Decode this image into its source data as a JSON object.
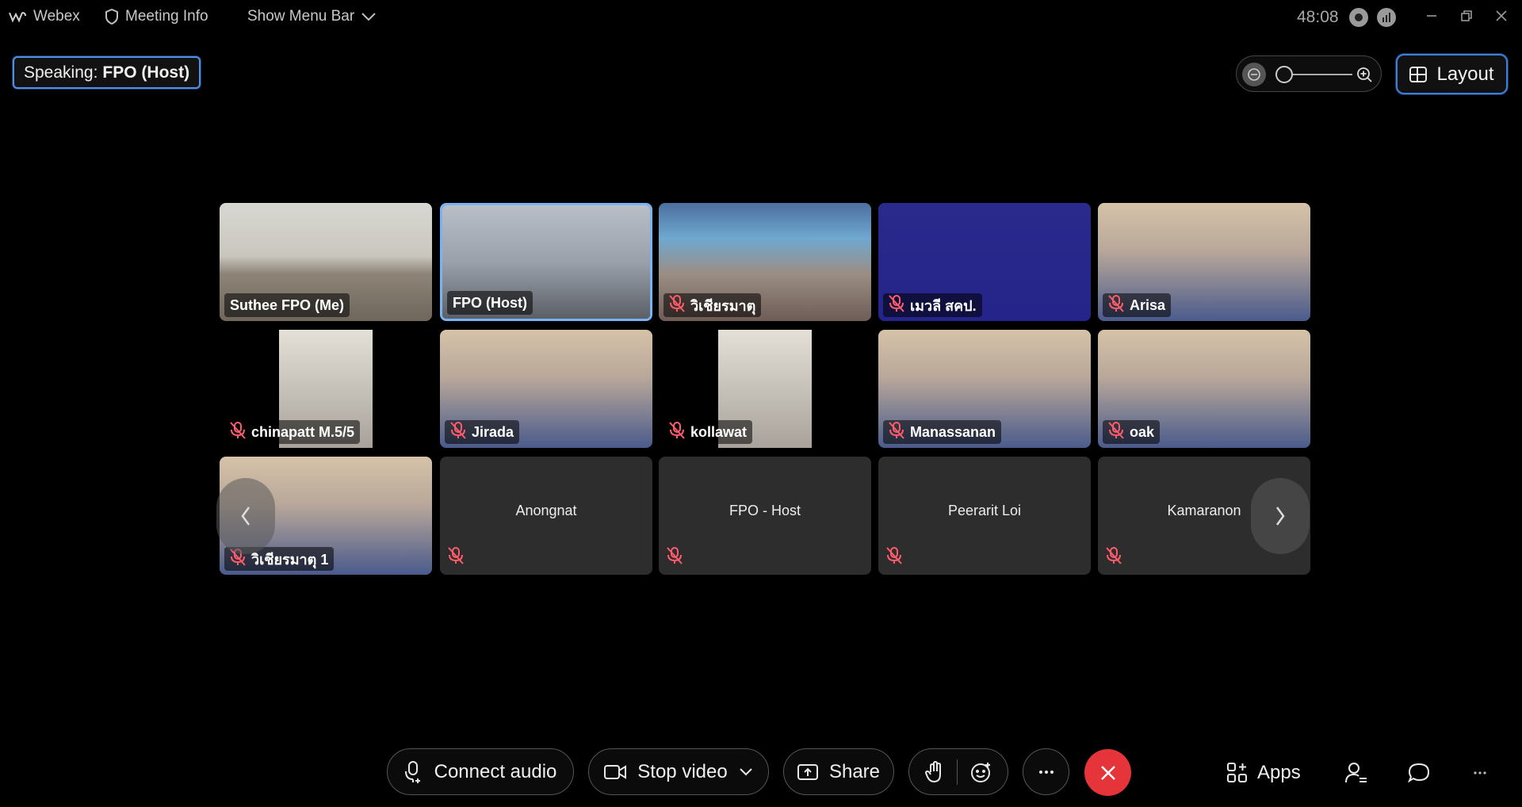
{
  "titlebar": {
    "app_name": "Webex",
    "meeting_info": "Meeting Info",
    "show_menu_bar": "Show Menu Bar",
    "timer": "48:08"
  },
  "speaking": {
    "label": "Speaking:",
    "name": "FPO (Host)"
  },
  "layout_label": "Layout",
  "participants": [
    {
      "name": "Suthee FPO (Me)",
      "muted": false,
      "video": true
    },
    {
      "name": "FPO (Host)",
      "muted": false,
      "video": true,
      "active": true
    },
    {
      "name": "วิเชียรมาตุ",
      "muted": true,
      "video": true
    },
    {
      "name": "เมวลี สคป.",
      "muted": true,
      "video": true
    },
    {
      "name": "Arisa",
      "muted": true,
      "video": true
    },
    {
      "name": "chinapatt M.5/5",
      "muted": true,
      "video": true
    },
    {
      "name": "Jirada",
      "muted": true,
      "video": true
    },
    {
      "name": "kollawat",
      "muted": true,
      "video": true
    },
    {
      "name": "Manassanan",
      "muted": true,
      "video": true
    },
    {
      "name": "oak",
      "muted": true,
      "video": true
    },
    {
      "name": "วิเชียรมาตุ 1",
      "muted": true,
      "video": true
    },
    {
      "name": "Anongnat",
      "muted": true,
      "video": false
    },
    {
      "name": "FPO - Host",
      "muted": true,
      "video": false
    },
    {
      "name": "Peerarit Loi",
      "muted": true,
      "video": false
    },
    {
      "name": "Kamaranon",
      "muted": true,
      "video": false
    }
  ],
  "controls": {
    "connect_audio": "Connect audio",
    "stop_video": "Stop video",
    "share": "Share",
    "apps": "Apps"
  },
  "colors": {
    "accent": "#4f8fe6",
    "end_call": "#e5343a",
    "muted_icon": "#ff5c6b"
  }
}
